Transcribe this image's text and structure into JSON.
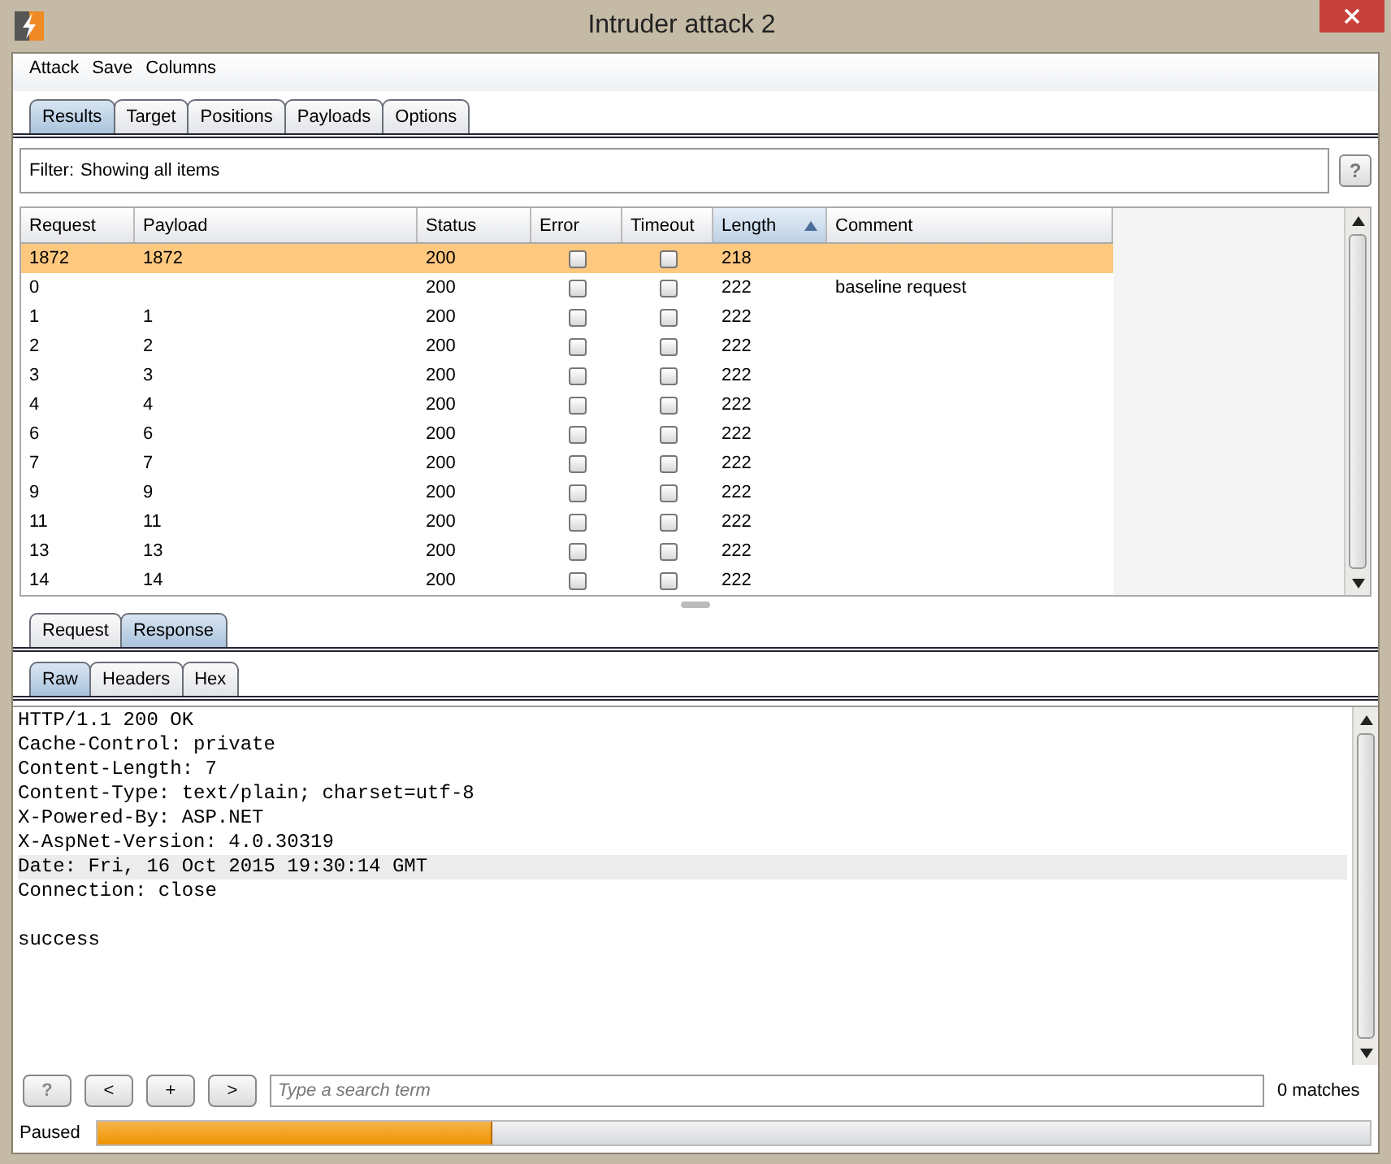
{
  "window": {
    "title": "Intruder attack 2"
  },
  "menu": [
    "Attack",
    "Save",
    "Columns"
  ],
  "tabs": [
    {
      "label": "Results",
      "selected": true
    },
    {
      "label": "Target",
      "selected": false
    },
    {
      "label": "Positions",
      "selected": false
    },
    {
      "label": "Payloads",
      "selected": false
    },
    {
      "label": "Options",
      "selected": false
    }
  ],
  "filter": {
    "label": "Filter:",
    "value": "Showing all items",
    "help": "?"
  },
  "table": {
    "columns": [
      {
        "label": "Request",
        "sorted": false
      },
      {
        "label": "Payload",
        "sorted": false
      },
      {
        "label": "Status",
        "sorted": false
      },
      {
        "label": "Error",
        "sorted": false
      },
      {
        "label": "Timeout",
        "sorted": false
      },
      {
        "label": "Length",
        "sorted": true
      },
      {
        "label": "Comment",
        "sorted": false
      }
    ],
    "rows": [
      {
        "request": "1872",
        "payload": "1872",
        "status": "200",
        "error": false,
        "timeout": false,
        "length": "218",
        "comment": "",
        "selected": true
      },
      {
        "request": "0",
        "payload": "",
        "status": "200",
        "error": false,
        "timeout": false,
        "length": "222",
        "comment": "baseline request",
        "selected": false
      },
      {
        "request": "1",
        "payload": "1",
        "status": "200",
        "error": false,
        "timeout": false,
        "length": "222",
        "comment": "",
        "selected": false
      },
      {
        "request": "2",
        "payload": "2",
        "status": "200",
        "error": false,
        "timeout": false,
        "length": "222",
        "comment": "",
        "selected": false
      },
      {
        "request": "3",
        "payload": "3",
        "status": "200",
        "error": false,
        "timeout": false,
        "length": "222",
        "comment": "",
        "selected": false
      },
      {
        "request": "4",
        "payload": "4",
        "status": "200",
        "error": false,
        "timeout": false,
        "length": "222",
        "comment": "",
        "selected": false
      },
      {
        "request": "6",
        "payload": "6",
        "status": "200",
        "error": false,
        "timeout": false,
        "length": "222",
        "comment": "",
        "selected": false
      },
      {
        "request": "7",
        "payload": "7",
        "status": "200",
        "error": false,
        "timeout": false,
        "length": "222",
        "comment": "",
        "selected": false
      },
      {
        "request": "9",
        "payload": "9",
        "status": "200",
        "error": false,
        "timeout": false,
        "length": "222",
        "comment": "",
        "selected": false
      },
      {
        "request": "11",
        "payload": "11",
        "status": "200",
        "error": false,
        "timeout": false,
        "length": "222",
        "comment": "",
        "selected": false
      },
      {
        "request": "13",
        "payload": "13",
        "status": "200",
        "error": false,
        "timeout": false,
        "length": "222",
        "comment": "",
        "selected": false
      },
      {
        "request": "14",
        "payload": "14",
        "status": "200",
        "error": false,
        "timeout": false,
        "length": "222",
        "comment": "",
        "selected": false
      }
    ]
  },
  "message_tabs": [
    {
      "label": "Request",
      "selected": false
    },
    {
      "label": "Response",
      "selected": true
    }
  ],
  "view_tabs": [
    {
      "label": "Raw",
      "selected": true
    },
    {
      "label": "Headers",
      "selected": false
    },
    {
      "label": "Hex",
      "selected": false
    }
  ],
  "response_lines": [
    {
      "text": "HTTP/1.1 200 OK",
      "highlighted": false
    },
    {
      "text": "Cache-Control: private",
      "highlighted": false
    },
    {
      "text": "Content-Length: 7",
      "highlighted": false
    },
    {
      "text": "Content-Type: text/plain; charset=utf-8",
      "highlighted": false
    },
    {
      "text": "X-Powered-By: ASP.NET",
      "highlighted": false
    },
    {
      "text": "X-AspNet-Version: 4.0.30319",
      "highlighted": false
    },
    {
      "text": "Date: Fri, 16 Oct 2015 19:30:14 GMT",
      "highlighted": true
    },
    {
      "text": "Connection: close",
      "highlighted": false
    },
    {
      "highlighted": false
    },
    {
      "text": "success",
      "highlighted": false
    }
  ],
  "search": {
    "buttons": [
      "?",
      "<",
      "+",
      ">"
    ],
    "placeholder": "Type a search term",
    "matches": "0 matches"
  },
  "status_bar": {
    "label": "Paused",
    "level": 0.31
  }
}
